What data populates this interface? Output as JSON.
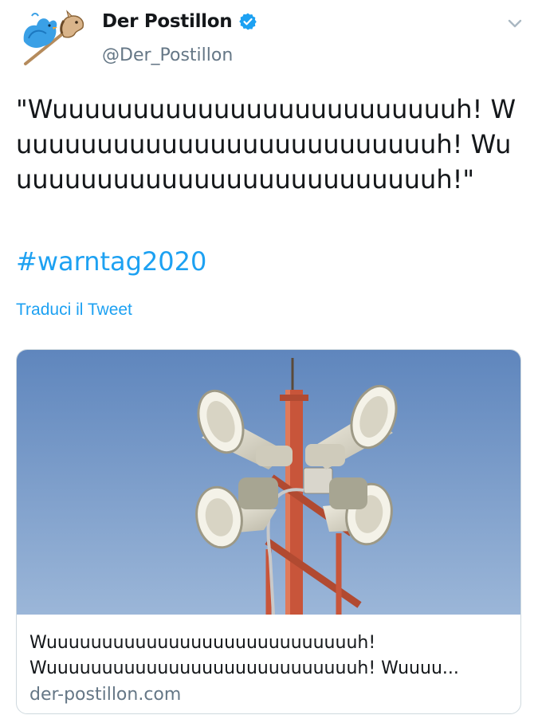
{
  "account": {
    "name": "Der Postillon",
    "handle": "@Der_Postillon",
    "avatar_icon": "bird-with-hobby-horse-avatar",
    "verified_icon": "verified-badge-icon"
  },
  "tweet": {
    "text": "\"Wuuuuuuuuuuuuuuuuuuuuuuuuuh! Wuuuuuuuuuuuuuuuuuuuuuuuuuuh! Wuuuuuuuuuuuuuuuuuuuuuuuuuuuh!\"",
    "hashtag": "#warntag2020",
    "translate_label": "Traduci il Tweet"
  },
  "card": {
    "image_subject": "siren-tower-image",
    "title_line1": "Wuuuuuuuuuuuuuuuuuuuuuuuuuuuuh!",
    "title_line2": "Wuuuuuuuuuuuuuuuuuuuuuuuuuuuuh! Wuuuu...",
    "domain": "der-postillon.com"
  },
  "colors": {
    "link": "#1da1f2",
    "secondary_text": "#657786",
    "primary_text": "#14171a",
    "sky": "#7d9fcb"
  }
}
